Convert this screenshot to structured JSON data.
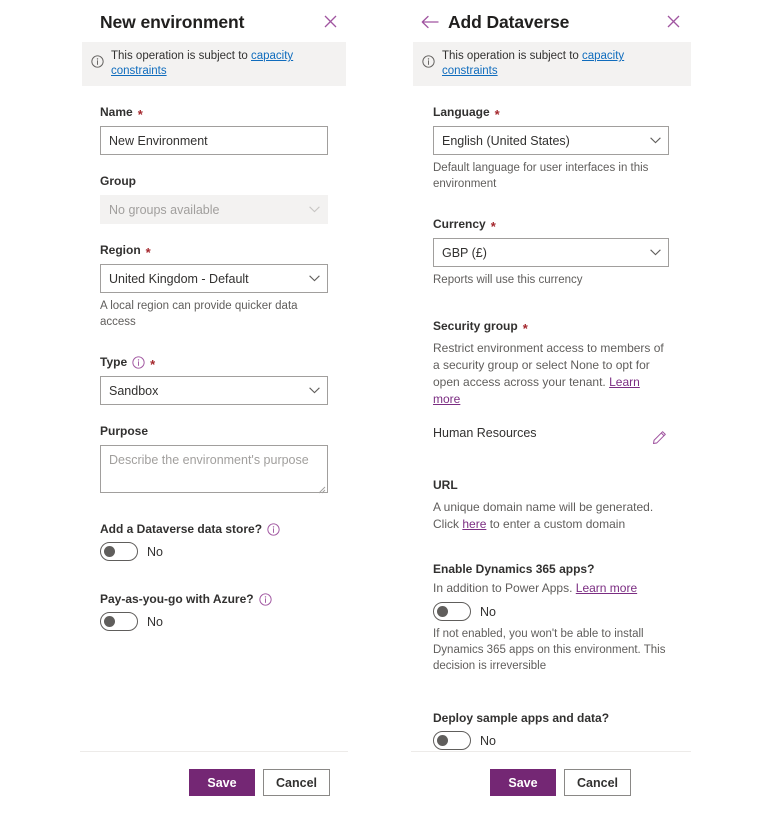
{
  "colors": {
    "accent_purple": "#742774",
    "icon_purple": "#a055a0",
    "link_blue": "#0f6cbd",
    "required_red": "#a4262c",
    "banner_bg": "#f3f2f1"
  },
  "left_panel": {
    "title": "New environment",
    "close_icon": "close-icon",
    "banner": {
      "icon": "info-icon",
      "text": "This operation is subject to ",
      "link": "capacity constraints"
    },
    "fields": {
      "name": {
        "label": "Name",
        "required": "*",
        "value": "New Environment"
      },
      "group": {
        "label": "Group",
        "value": "No groups available",
        "disabled": true
      },
      "region": {
        "label": "Region",
        "required": "*",
        "value": "United Kingdom - Default",
        "helper": "A local region can provide quicker data access"
      },
      "type": {
        "label": "Type",
        "required": "*",
        "info_icon": "info-icon",
        "value": "Sandbox"
      },
      "purpose": {
        "label": "Purpose",
        "placeholder": "Describe the environment's purpose"
      },
      "dataverse_toggle": {
        "label": "Add a Dataverse data store?",
        "info_icon": "info-icon",
        "state": "No"
      },
      "payg_toggle": {
        "label": "Pay-as-you-go with Azure?",
        "info_icon": "info-icon",
        "state": "No"
      }
    },
    "footer": {
      "save_label": "Save",
      "cancel_label": "Cancel"
    }
  },
  "right_panel": {
    "back_icon": "back-arrow-icon",
    "title": "Add Dataverse",
    "close_icon": "close-icon",
    "banner": {
      "icon": "info-icon",
      "text": "This operation is subject to ",
      "link": "capacity constraints"
    },
    "fields": {
      "language": {
        "label": "Language",
        "required": "*",
        "value": "English (United States)",
        "helper": "Default language for user interfaces in this environment"
      },
      "currency": {
        "label": "Currency",
        "required": "*",
        "value": "GBP (£)",
        "helper": "Reports will use this currency"
      },
      "security_group": {
        "label": "Security group",
        "required": "*",
        "desc_before": "Restrict environment access to members of a security group or select None to opt for open access across your tenant. ",
        "desc_link": "Learn more",
        "value": "Human Resources",
        "edit_icon": "pencil-icon"
      },
      "url": {
        "label": "URL",
        "desc_before": "A unique domain name will be generated. Click ",
        "desc_link": "here",
        "desc_after": " to enter a custom domain"
      },
      "dynamics_toggle": {
        "label": "Enable Dynamics 365 apps?",
        "desc_before": "In addition to Power Apps. ",
        "desc_link": "Learn more",
        "state": "No",
        "helper": "If not enabled, you won't be able to install Dynamics 365 apps on this environment. This decision is irreversible"
      },
      "sample_apps_toggle": {
        "label": "Deploy sample apps and data?",
        "state": "No"
      }
    },
    "footer": {
      "save_label": "Save",
      "cancel_label": "Cancel"
    }
  }
}
